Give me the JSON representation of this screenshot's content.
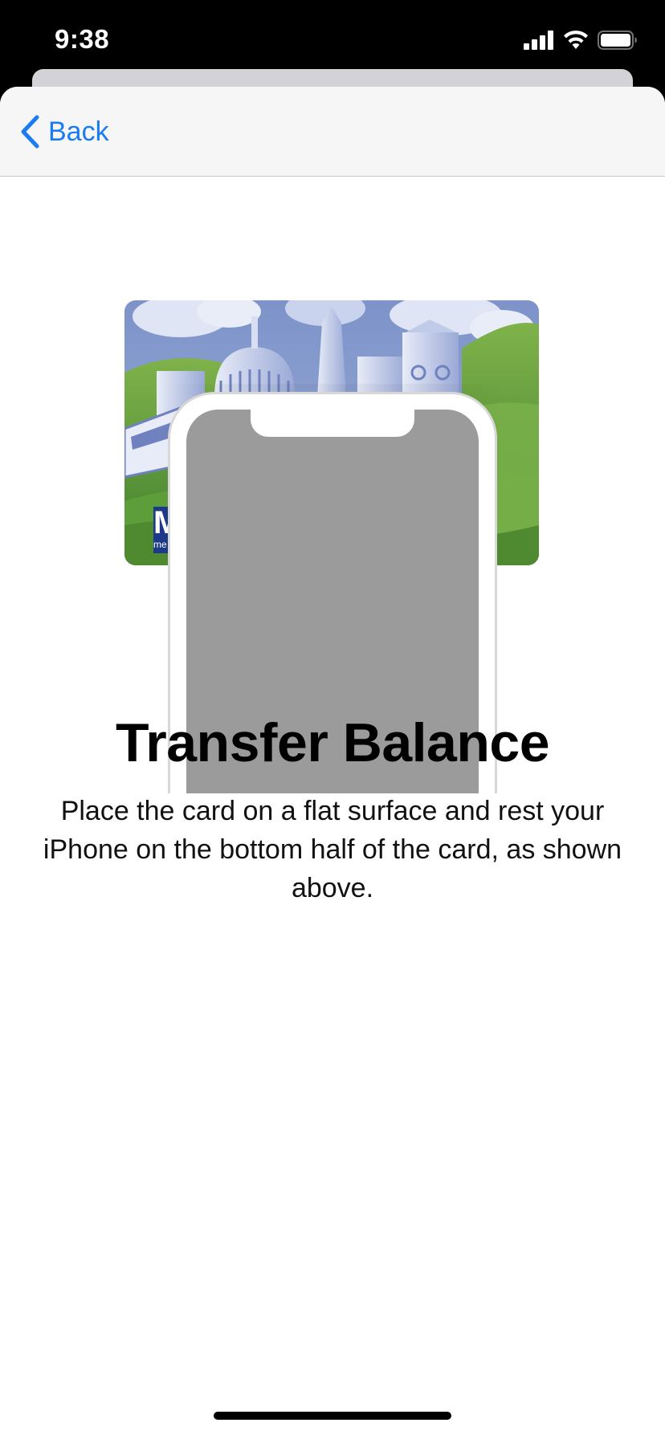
{
  "status_bar": {
    "time": "9:38",
    "signal_icon": "cellular-signal-icon",
    "wifi_icon": "wifi-icon",
    "battery_icon": "battery-icon",
    "battery_level": 1.0
  },
  "nav": {
    "back_label": "Back",
    "back_icon": "chevron-left-icon"
  },
  "illustration": {
    "card_logo_text": "M",
    "card_logo_subtext": "me"
  },
  "content": {
    "title": "Transfer Balance",
    "body": "Place the card on a flat surface and rest your iPhone on the bottom half of the card, as shown above."
  },
  "colors": {
    "accent": "#1a7cf3",
    "nav_background": "#f6f6f6",
    "phone_screen": "#9b9b9b"
  }
}
